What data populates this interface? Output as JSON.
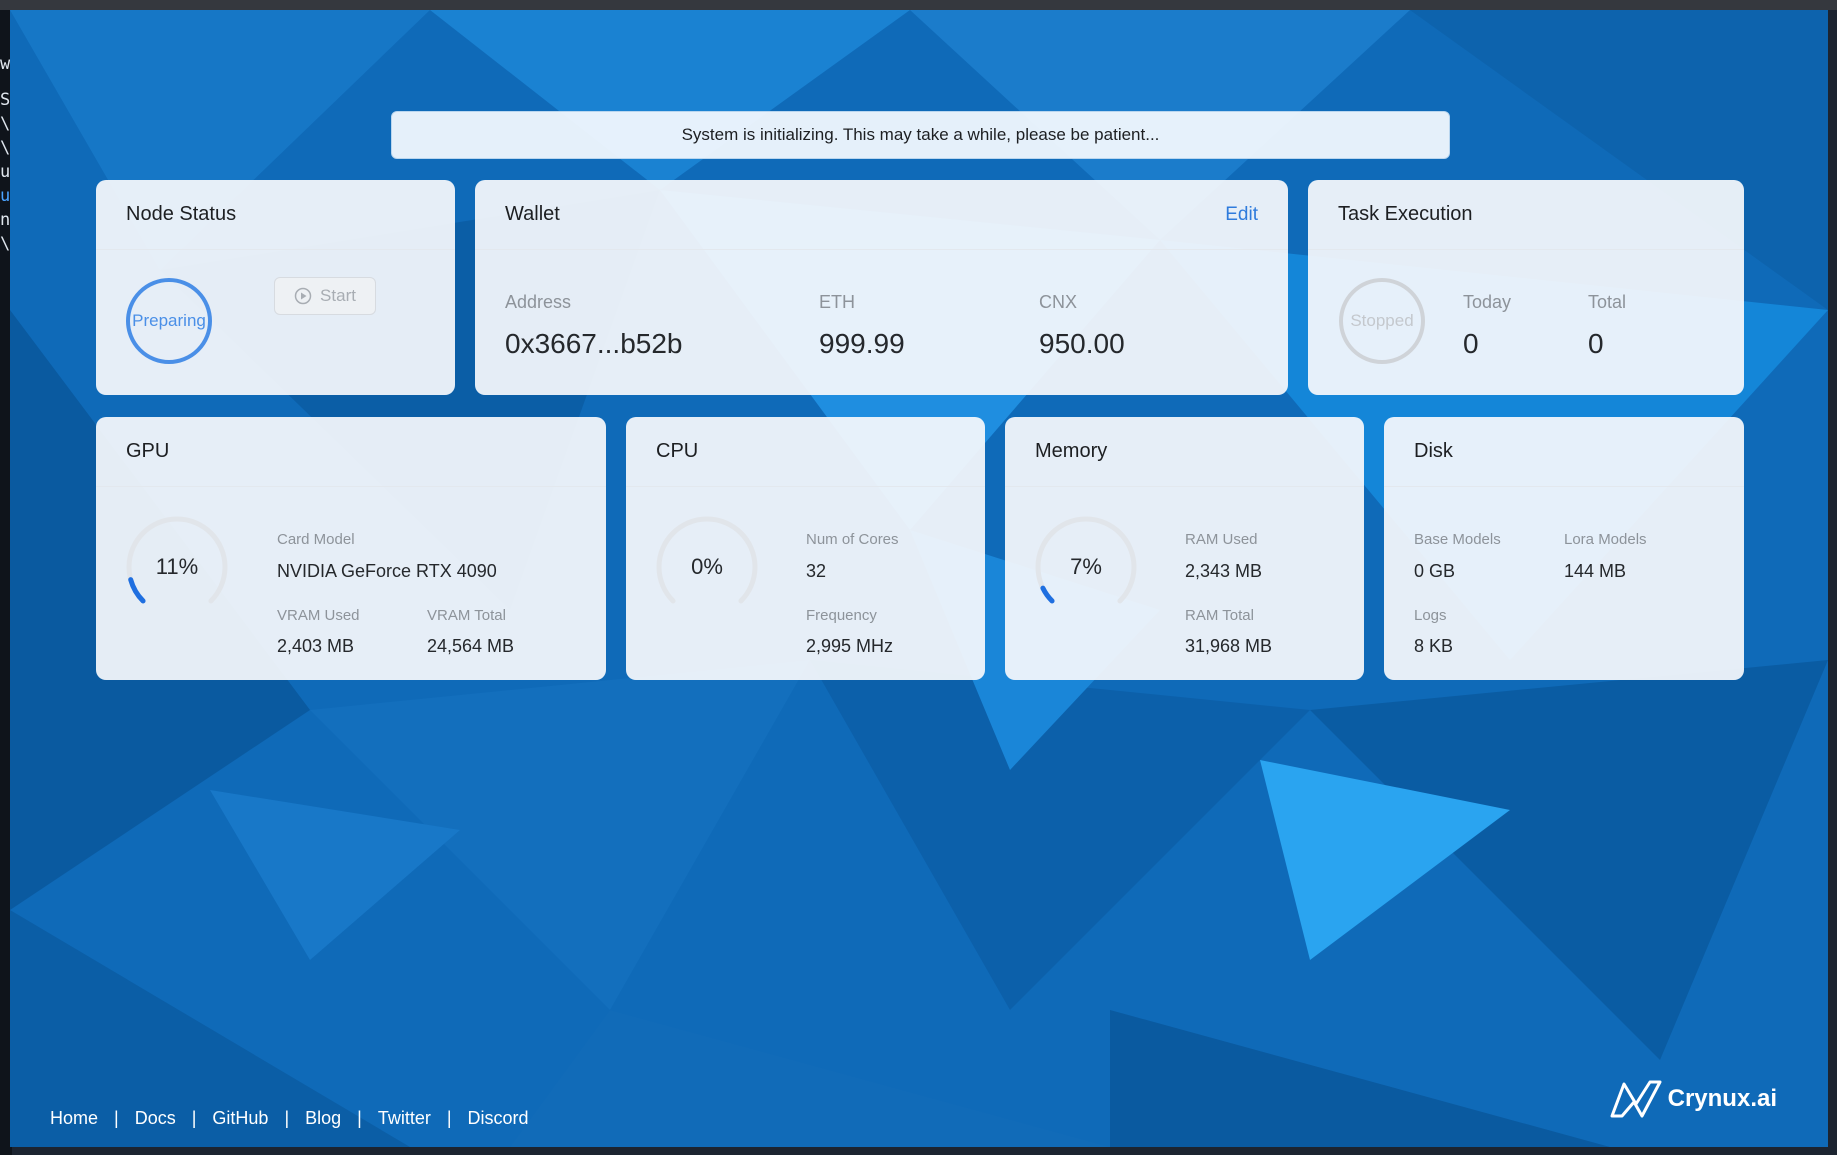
{
  "background_terminal": {
    "lines": [
      "w",
      "S",
      "\\",
      "\\",
      "u",
      "u",
      "n",
      "\\"
    ]
  },
  "notice": {
    "text": "System is initializing. This may take a while, please be patient..."
  },
  "node_status": {
    "title": "Node Status",
    "state": "Preparing",
    "start_label": "Start"
  },
  "wallet": {
    "title": "Wallet",
    "edit_label": "Edit",
    "address_label": "Address",
    "address": "0x3667...b52b",
    "eth_label": "ETH",
    "eth": "999.99",
    "cnx_label": "CNX",
    "cnx": "950.00"
  },
  "task": {
    "title": "Task Execution",
    "state": "Stopped",
    "today_label": "Today",
    "today": "0",
    "total_label": "Total",
    "total": "0"
  },
  "gpu": {
    "title": "GPU",
    "usage": "11%",
    "usage_fraction": 0.11,
    "card_model_label": "Card Model",
    "card_model": "NVIDIA GeForce RTX 4090",
    "vram_used_label": "VRAM Used",
    "vram_used": "2,403 MB",
    "vram_total_label": "VRAM Total",
    "vram_total": "24,564 MB"
  },
  "cpu": {
    "title": "CPU",
    "usage": "0%",
    "usage_fraction": 0,
    "cores_label": "Num of Cores",
    "cores": "32",
    "freq_label": "Frequency",
    "freq": "2,995 MHz"
  },
  "memory": {
    "title": "Memory",
    "usage": "7%",
    "usage_fraction": 0.07,
    "ram_used_label": "RAM Used",
    "ram_used": "2,343 MB",
    "ram_total_label": "RAM Total",
    "ram_total": "31,968 MB"
  },
  "disk": {
    "title": "Disk",
    "base_models_label": "Base Models",
    "base_models": "0 GB",
    "lora_models_label": "Lora Models",
    "lora_models": "144 MB",
    "logs_label": "Logs",
    "logs": "8 KB"
  },
  "footer": {
    "links": [
      "Home",
      "Docs",
      "GitHub",
      "Blog",
      "Twitter",
      "Discord"
    ],
    "separator": "|"
  },
  "brand": {
    "name": "Crynux.ai"
  },
  "colors": {
    "accent": "#2f7bdc",
    "gauge_track": "#e1e5ea",
    "gauge_fill": "#1f6fe0",
    "ring_preparing": "#4a8fe7",
    "ring_stopped": "#cfd3d8"
  }
}
